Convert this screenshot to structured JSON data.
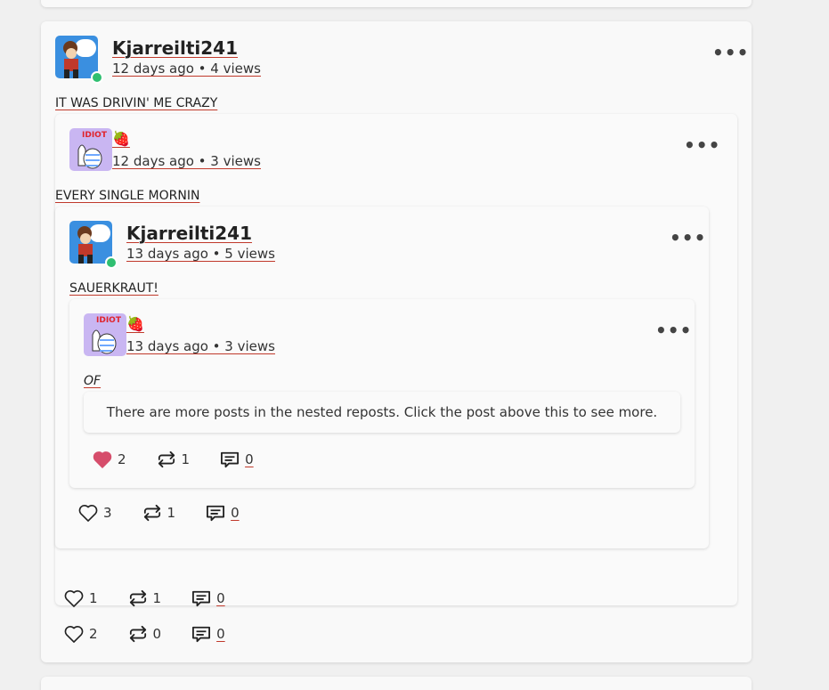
{
  "posts": {
    "outer": {
      "username": "Kjarreilti241",
      "meta": "12 days ago • 4 views",
      "text": "IT WAS DRIVIN' ME CRAZY",
      "likes": "2",
      "reposts": "0",
      "comments": "0"
    },
    "repost1": {
      "username": "🍓",
      "meta": "12 days ago • 3 views",
      "text": "EVERY SINGLE MORNIN",
      "likes": "1",
      "reposts": "1",
      "comments": "0"
    },
    "repost2": {
      "username": "Kjarreilti241",
      "meta": "13 days ago • 5 views",
      "text": "SAUERKRAUT!",
      "likes": "3",
      "reposts": "1",
      "comments": "0"
    },
    "repost3": {
      "username": "🍓",
      "meta": "13 days ago • 3 views",
      "text": "OF",
      "likes": "2",
      "reposts": "1",
      "comments": "0",
      "liked": true
    }
  },
  "notice": "There are more posts in the nested reposts. Click the post above this to see more.",
  "more_label": "•••",
  "avatar_idiot_text": "IDIOT",
  "colors": {
    "liked_heart": "#d64d6b",
    "online": "#2fbf71",
    "underline": "#c0392b"
  },
  "icons": {
    "like": "heart-icon",
    "repost": "repost-icon",
    "comment": "comment-icon",
    "more": "more-options-icon"
  }
}
